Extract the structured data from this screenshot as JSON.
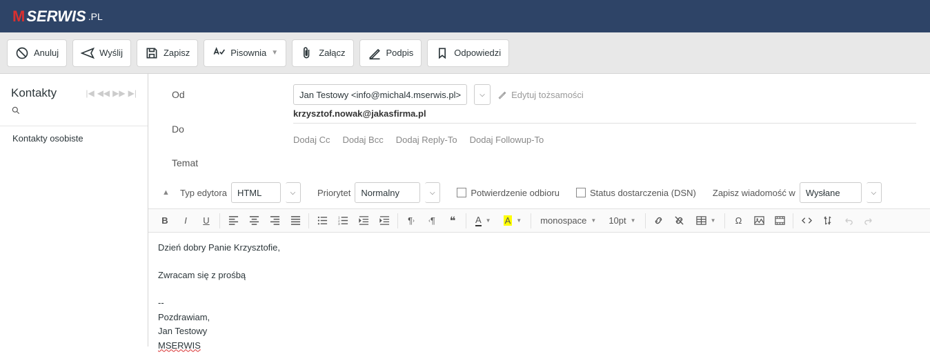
{
  "logo": {
    "part1": "M",
    "part2": "SERWIS",
    "part3": ".PL"
  },
  "toolbar": {
    "cancel": "Anuluj",
    "send": "Wyślij",
    "save": "Zapisz",
    "spell": "Pisownia",
    "attach": "Załącz",
    "signature": "Podpis",
    "responses": "Odpowiedzi"
  },
  "sidebar": {
    "title": "Kontakty",
    "item1": "Kontakty osobiste"
  },
  "compose": {
    "from_label": "Od",
    "from_value": "Jan Testowy <info@michal4.mserwis.pl>",
    "edit_identity": "Edytuj tożsamości",
    "to_label": "Do",
    "to_value": "krzysztof.nowak@jakasfirma.pl",
    "add_cc": "Dodaj Cc",
    "add_bcc": "Dodaj Bcc",
    "add_replyto": "Dodaj Reply-To",
    "add_followupto": "Dodaj Followup-To",
    "subject_label": "Temat"
  },
  "options": {
    "editor_type_label": "Typ edytora",
    "editor_type_value": "HTML",
    "priority_label": "Priorytet",
    "priority_value": "Normalny",
    "receipt": "Potwierdzenie odbioru",
    "dsn": "Status dostarczenia (DSN)",
    "save_in_label": "Zapisz wiadomość w",
    "save_in_value": "Wysłane"
  },
  "editor": {
    "font_family": "monospace",
    "font_size": "10pt",
    "body_line1": "Dzień dobry Panie Krzysztofie,",
    "body_line2": "Zwracam się z prośbą",
    "body_line3": "--",
    "body_line4": "Pozdrawiam,",
    "body_line5": "Jan Testowy",
    "body_line6": "MSERWIS"
  }
}
